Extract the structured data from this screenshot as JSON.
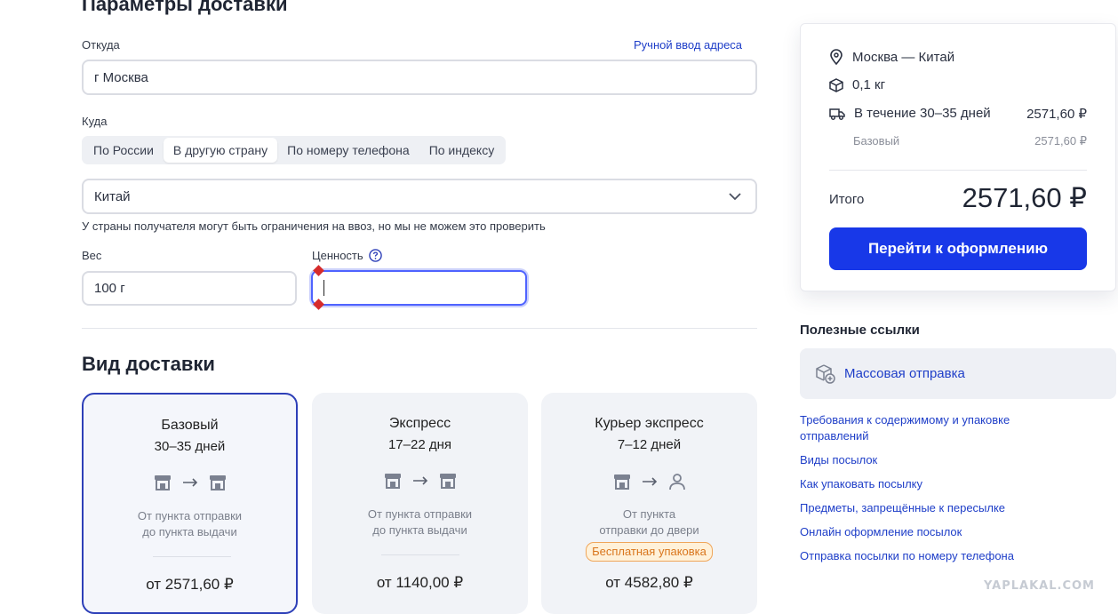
{
  "delivery_params": {
    "title": "Параметры доставки",
    "from_label": "Откуда",
    "manual_address_link": "Ручной ввод адреса",
    "from_value": "г Москва",
    "to_label": "Куда",
    "tabs": [
      {
        "label": "По России",
        "active": false
      },
      {
        "label": "В другую страну",
        "active": true
      },
      {
        "label": "По номеру телефона",
        "active": false
      },
      {
        "label": "По индексу",
        "active": false
      }
    ],
    "country_value": "Китай",
    "country_hint": "У страны получателя могут быть ограничения на ввоз, но мы не можем это проверить",
    "weight_label": "Вес",
    "weight_value": "100 г",
    "value_label": "Ценность",
    "value_value": ""
  },
  "delivery_type": {
    "title": "Вид доставки",
    "cards": [
      {
        "name": "Базовый",
        "days": "30–35 дней",
        "desc_1": "От пункта отправки",
        "desc_2": "до пункта выдачи",
        "price": "от 2571,60 ₽",
        "badge": "",
        "selected": true
      },
      {
        "name": "Экспресс",
        "days": "17–22 дня",
        "desc_1": "От пункта отправки",
        "desc_2": "до пункта выдачи",
        "price": "от 1140,00 ₽",
        "badge": "",
        "selected": false
      },
      {
        "name": "Курьер экспресс",
        "days": "7–12 дней",
        "desc_1": "От пункта",
        "desc_2": "отправки до двери",
        "price": "от 4582,80 ₽",
        "badge": "Бесплатная упаковка",
        "selected": false
      }
    ]
  },
  "summary": {
    "route": "Москва — Китай",
    "weight": "0,1 кг",
    "term": "В течение 30–35 дней",
    "term_price": "2571,60 ₽",
    "tariff": "Базовый",
    "tariff_price": "2571,60 ₽",
    "total_label": "Итого",
    "total_value": "2571,60 ₽",
    "cta": "Перейти к оформлению"
  },
  "useful": {
    "title": "Полезные ссылки",
    "mass_send": "Массовая отправка",
    "links": [
      "Требования к содержимому и упаковке отправлений",
      "Виды посылок",
      "Как упаковать посылку",
      "Предметы, запрещённые к пересылке",
      "Онлайн оформление посылок",
      "Отправка посылки по номеру телефона"
    ]
  },
  "watermark": "YAPLAKAL.COM",
  "colors": {
    "accent": "#1838e8",
    "link": "#1e3ec8",
    "selected_border": "#2d3fb8",
    "error": "#d62b2b",
    "badge_text": "#d9751c"
  }
}
